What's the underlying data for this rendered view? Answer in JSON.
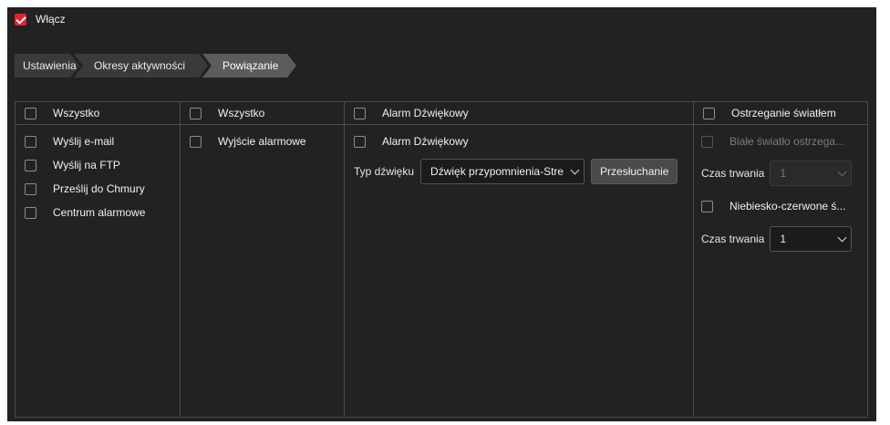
{
  "enable": {
    "label": "Włącz",
    "checked": true
  },
  "steps": [
    "Ustawienia",
    "Okresy aktywności",
    "Powiązanie"
  ],
  "col1": {
    "header": "Wszystko",
    "items": [
      "Wyślij e-mail",
      "Wyślij na FTP",
      "Prześlij do Chmury",
      "Centrum alarmowe"
    ]
  },
  "col2": {
    "header": "Wszystko",
    "items": [
      "Wyjście alarmowe"
    ]
  },
  "col3": {
    "header": "Alarm Dźwiękowy",
    "item": "Alarm Dźwiękowy",
    "sound_label": "Typ dźwięku",
    "sound_value": "Dźwięk przypomnienia-Stre",
    "listen_button": "Przesłuchanie"
  },
  "col4": {
    "header": "Ostrzeganie światłem",
    "white_light": "Białe światło ostrzega...",
    "duration_label": "Czas trwania",
    "duration_value_1": "1",
    "blue_red": "Niebiesko-czerwone ś...",
    "duration_value_2": "1"
  },
  "colors": {
    "accent": "#e1232d",
    "background": "#222222"
  }
}
